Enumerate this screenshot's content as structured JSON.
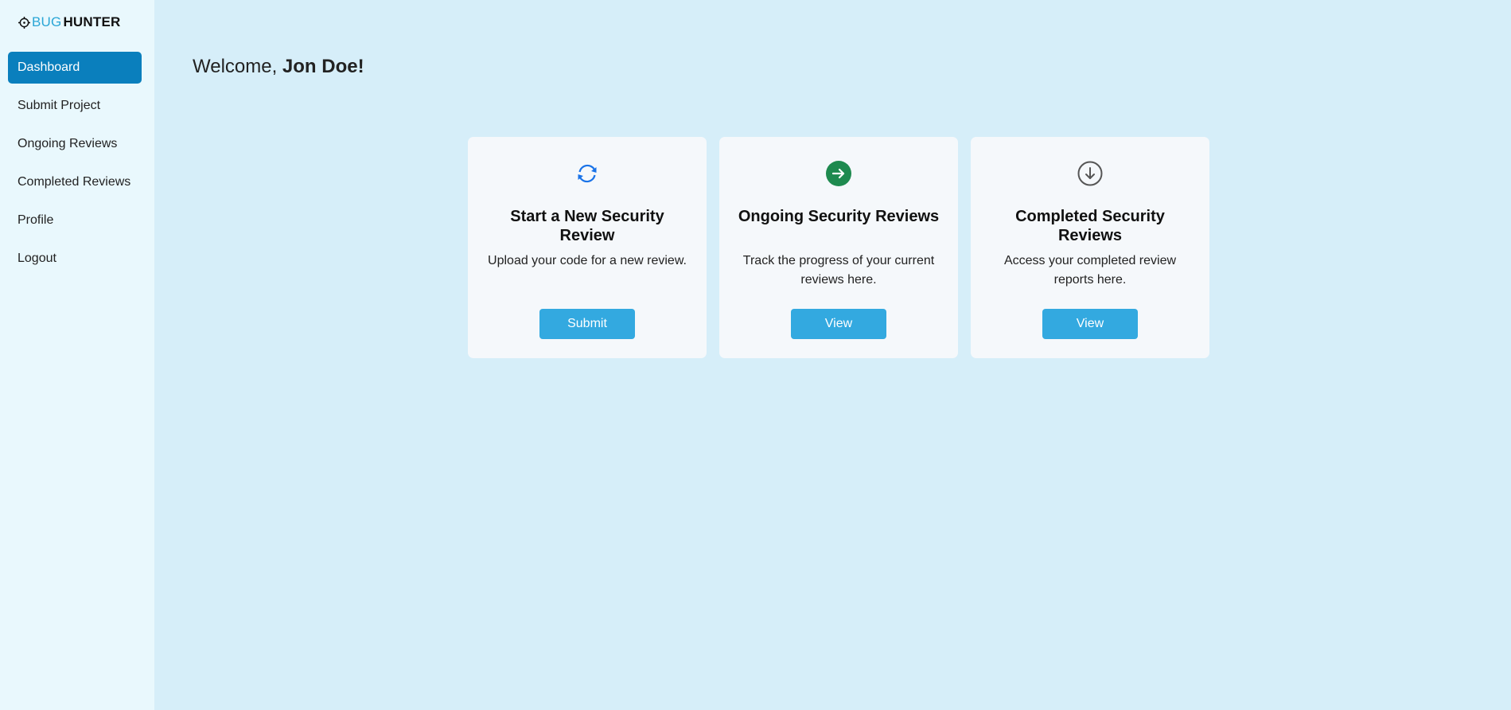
{
  "brand": {
    "part1": "BUG",
    "part2": "HUNTER",
    "icon": "crosshair-icon"
  },
  "sidebar": {
    "items": [
      {
        "label": "Dashboard",
        "active": true
      },
      {
        "label": "Submit Project"
      },
      {
        "label": "Ongoing Reviews"
      },
      {
        "label": "Completed Reviews"
      },
      {
        "label": "Profile"
      },
      {
        "label": "Logout"
      }
    ]
  },
  "main": {
    "welcome_prefix": "Welcome, ",
    "user_name": "Jon Doe!",
    "cards": [
      {
        "icon": "refresh-icon",
        "title": "Start a New Security Review",
        "description": "Upload your code for a new review.",
        "button": "Submit"
      },
      {
        "icon": "arrow-right-circle-icon",
        "title": "Ongoing Security Reviews",
        "description": "Track the progress of your current reviews here.",
        "button": "View"
      },
      {
        "icon": "arrow-down-circle-icon",
        "title": "Completed Security Reviews",
        "description": "Access your completed review reports here.",
        "button": "View"
      }
    ]
  },
  "colors": {
    "accent": "#0a7fbd",
    "button": "#33a9e0",
    "background": "#d6eef9",
    "sidebar": "#e9f8fd",
    "success": "#1e8a4f"
  }
}
